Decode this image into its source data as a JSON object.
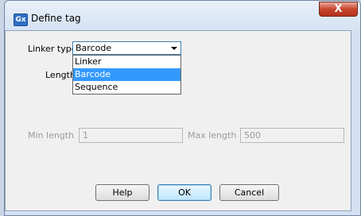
{
  "window": {
    "title": "Define tag",
    "app_icon_text": "Gx",
    "close_symbol": "X"
  },
  "form": {
    "linker_type_label": "Linker type",
    "linker_type_value": "Barcode",
    "length_label": "Length",
    "min_length_label": "Min length",
    "min_length_value": "1",
    "max_length_label": "Max length",
    "max_length_value": "500"
  },
  "dropdown": {
    "options": [
      "Linker",
      "Barcode",
      "Sequence"
    ],
    "selected": "Barcode"
  },
  "buttons": {
    "help": "Help",
    "ok": "OK",
    "cancel": "Cancel"
  },
  "colors": {
    "selection": "#3399ff",
    "close_button": "#c7462f",
    "focus_border": "#3c7fb1"
  },
  "icons": {
    "app": "app-icon",
    "close": "close-icon",
    "dropdown": "chevron-down-icon"
  }
}
